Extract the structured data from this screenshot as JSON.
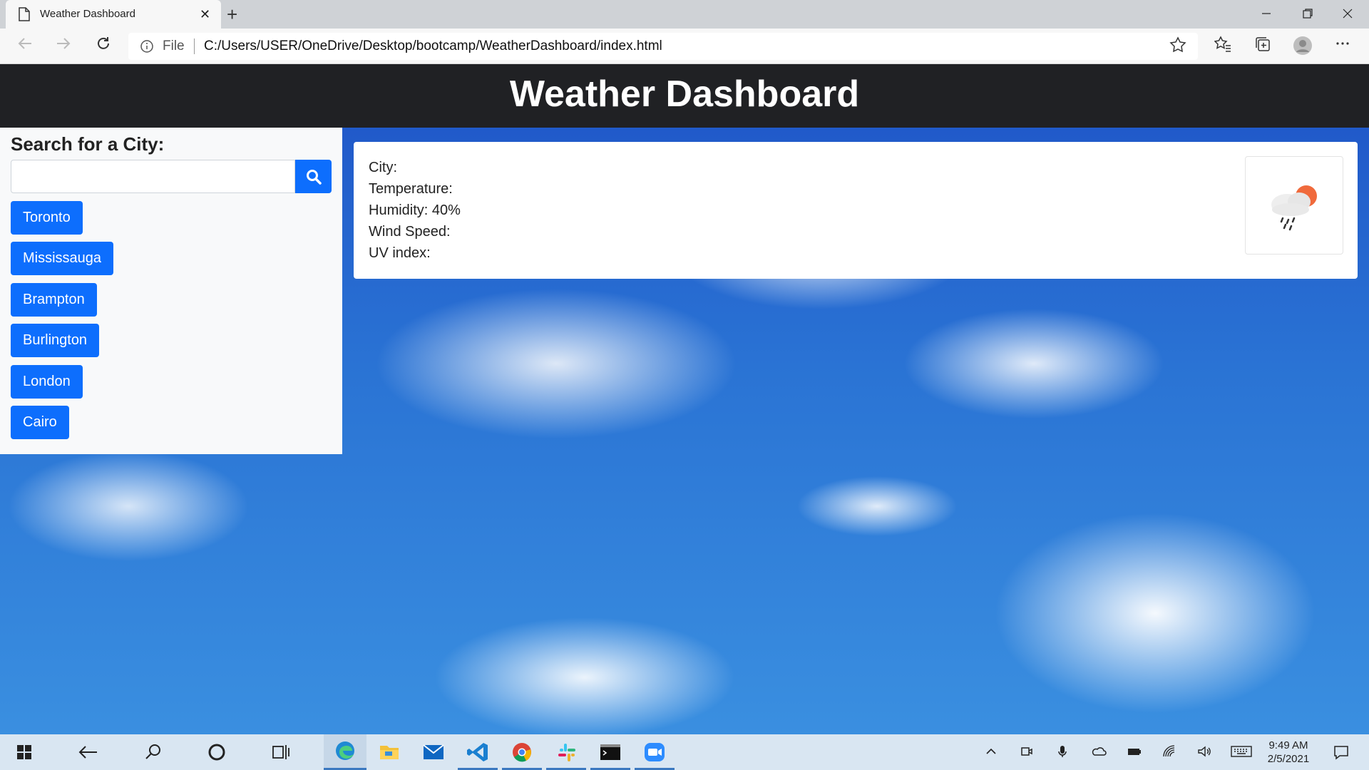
{
  "browser": {
    "tab_title": "Weather Dashboard",
    "tab_close": "✕",
    "new_tab": "+",
    "file_label": "File",
    "url": "C:/Users/USER/OneDrive/Desktop/bootcamp/WeatherDashboard/index.html",
    "window_controls": [
      "minimize-icon",
      "restore-icon",
      "close-icon"
    ]
  },
  "page": {
    "title": "Weather Dashboard"
  },
  "sidebar": {
    "heading": "Search for a City:",
    "search_value": "",
    "cities": [
      "Toronto",
      "Mississauga",
      "Brampton",
      "Burlington",
      "London",
      "Cairo"
    ]
  },
  "weather": {
    "city": "City:",
    "temperature": "Temperature:",
    "humidity": "Humidity: 40%",
    "wind": "Wind Speed:",
    "uv": "UV index:",
    "icon": "rain-cloud-sun-icon"
  },
  "taskbar": {
    "time": "9:49 AM",
    "date": "2/5/2021"
  },
  "colors": {
    "header_bg": "#202124",
    "button_blue": "#0d6efd",
    "sky": "#2a73d4"
  }
}
